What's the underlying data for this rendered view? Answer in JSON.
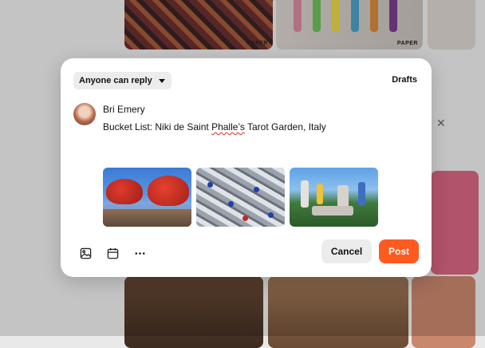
{
  "background": {
    "tags": [
      "PAPER",
      "PAPER"
    ]
  },
  "composer": {
    "audience_label": "Anyone can reply",
    "drafts_label": "Drafts",
    "author_name": "Bri Emery",
    "post_text_before": "Bucket List: Niki de Saint ",
    "post_text_flagged": "Phalle’s",
    "post_text_after": " Tarot Garden, Italy",
    "attachments": [
      {
        "name": "tarot-garden-red-sculpture-photo"
      },
      {
        "name": "tarot-garden-mirror-mosaic-photo"
      },
      {
        "name": "tarot-garden-overview-photo"
      }
    ],
    "tools": [
      "image-icon",
      "calendar-icon",
      "more-icon"
    ],
    "cancel_label": "Cancel",
    "post_label": "Post"
  },
  "colors": {
    "accent": "#ff5a1f"
  }
}
